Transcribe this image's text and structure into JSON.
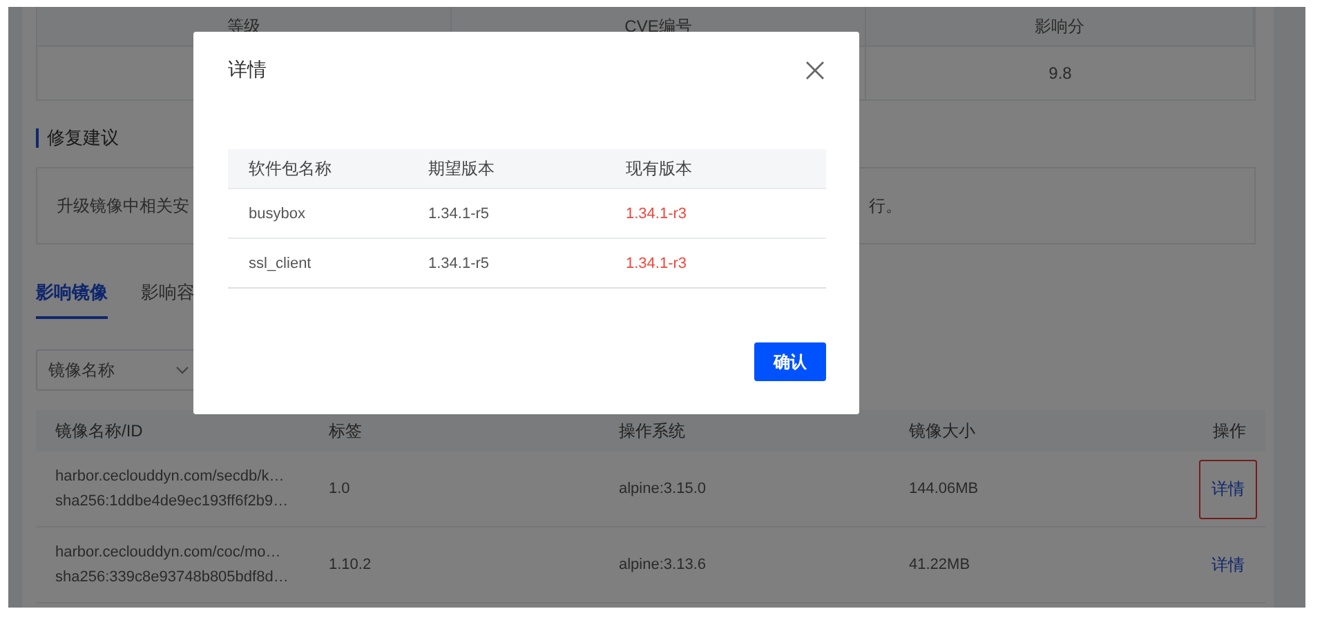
{
  "score_table": {
    "columns": [
      "等级",
      "CVE编号",
      "影响分"
    ],
    "row": {
      "score": "9.8"
    }
  },
  "fix_section": {
    "title": "修复建议",
    "text_left": "升级镜像中相关安",
    "text_right": "行。"
  },
  "tabs": [
    {
      "label": "影响镜像",
      "selected": true
    },
    {
      "label": "影响容",
      "selected": false
    }
  ],
  "filter": {
    "value": "镜像名称"
  },
  "image_table": {
    "columns": [
      "镜像名称/ID",
      "标签",
      "操作系统",
      "镜像大小",
      "操作"
    ],
    "rows": [
      {
        "name": "harbor.ceclouddyn.com/secdb/k…",
        "id": "sha256:1ddbe4de9ec193ff6f2b9…",
        "tag": "1.0",
        "os": "alpine:3.15.0",
        "size": "144.06MB",
        "action": "详情",
        "highlighted": true
      },
      {
        "name": "harbor.ceclouddyn.com/coc/mo…",
        "id": "sha256:339c8e93748b805bdf8d…",
        "tag": "1.10.2",
        "os": "alpine:3.13.6",
        "size": "41.22MB",
        "action": "详情",
        "highlighted": false
      }
    ]
  },
  "dialog": {
    "title": "详情",
    "columns": [
      "软件包名称",
      "期望版本",
      "现有版本"
    ],
    "rows": [
      [
        "busybox",
        "1.34.1-r5",
        "1.34.1-r3"
      ],
      [
        "ssl_client",
        "1.34.1-r5",
        "1.34.1-r3"
      ]
    ],
    "confirm": "确认"
  }
}
